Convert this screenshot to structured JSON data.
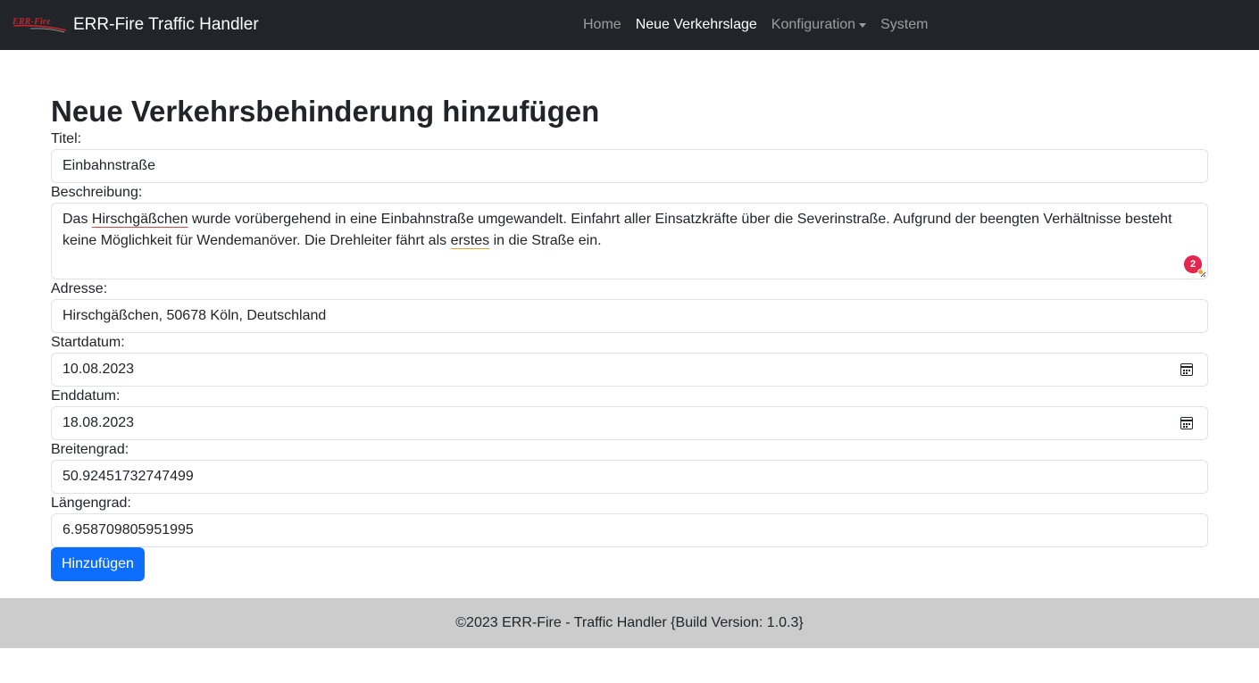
{
  "navbar": {
    "logo_text": "ERR-Fire",
    "brand": "ERR-Fire Traffic Handler",
    "links": [
      {
        "label": "Home"
      },
      {
        "label": "Neue Verkehrslage"
      },
      {
        "label": "Konfiguration"
      },
      {
        "label": "System"
      }
    ],
    "active": "Neue Verkehrslage"
  },
  "page": {
    "title": "Neue Verkehrsbehinderung hinzufügen"
  },
  "form": {
    "titel_label": "Titel:",
    "titel_value": "Einbahnstraße",
    "beschreibung_label": "Beschreibung:",
    "beschreibung_parts": [
      "Das ",
      "Hirschgäßchen",
      " wurde vorübergehend in eine Einbahnstraße umgewandelt. Einfahrt aller Einsatzkräfte über die Severinstraße. Aufgrund der beengten Verhältnisse besteht keine Möglichkeit für Wendemanöver. Die Drehleiter fährt als ",
      "erstes",
      " in die Straße ein."
    ],
    "spellcheck_count": "2",
    "adresse_label": "Adresse:",
    "adresse_value": "Hirschgäßchen, 50678 Köln, Deutschland",
    "startdatum_label": "Startdatum:",
    "startdatum_value": "10.08.2023",
    "enddatum_label": "Enddatum:",
    "enddatum_value": "18.08.2023",
    "breitengrad_label": "Breitengrad:",
    "breitengrad_value": "50.92451732747499",
    "laengengrad_label": "Längengrad:",
    "laengengrad_value": "6.958709805951995",
    "submit_label": "Hinzufügen"
  },
  "footer": {
    "text": "©2023 ERR-Fire - Traffic Handler {Build Version: 1.0.3}"
  },
  "colors": {
    "navbar_bg": "#212529",
    "primary": "#0d6efd",
    "footer_bg": "#cccccc",
    "logo_red": "#c0262c"
  },
  "icons": {
    "date_picker": "calendar-icon",
    "dropdown": "caret-down-icon"
  }
}
